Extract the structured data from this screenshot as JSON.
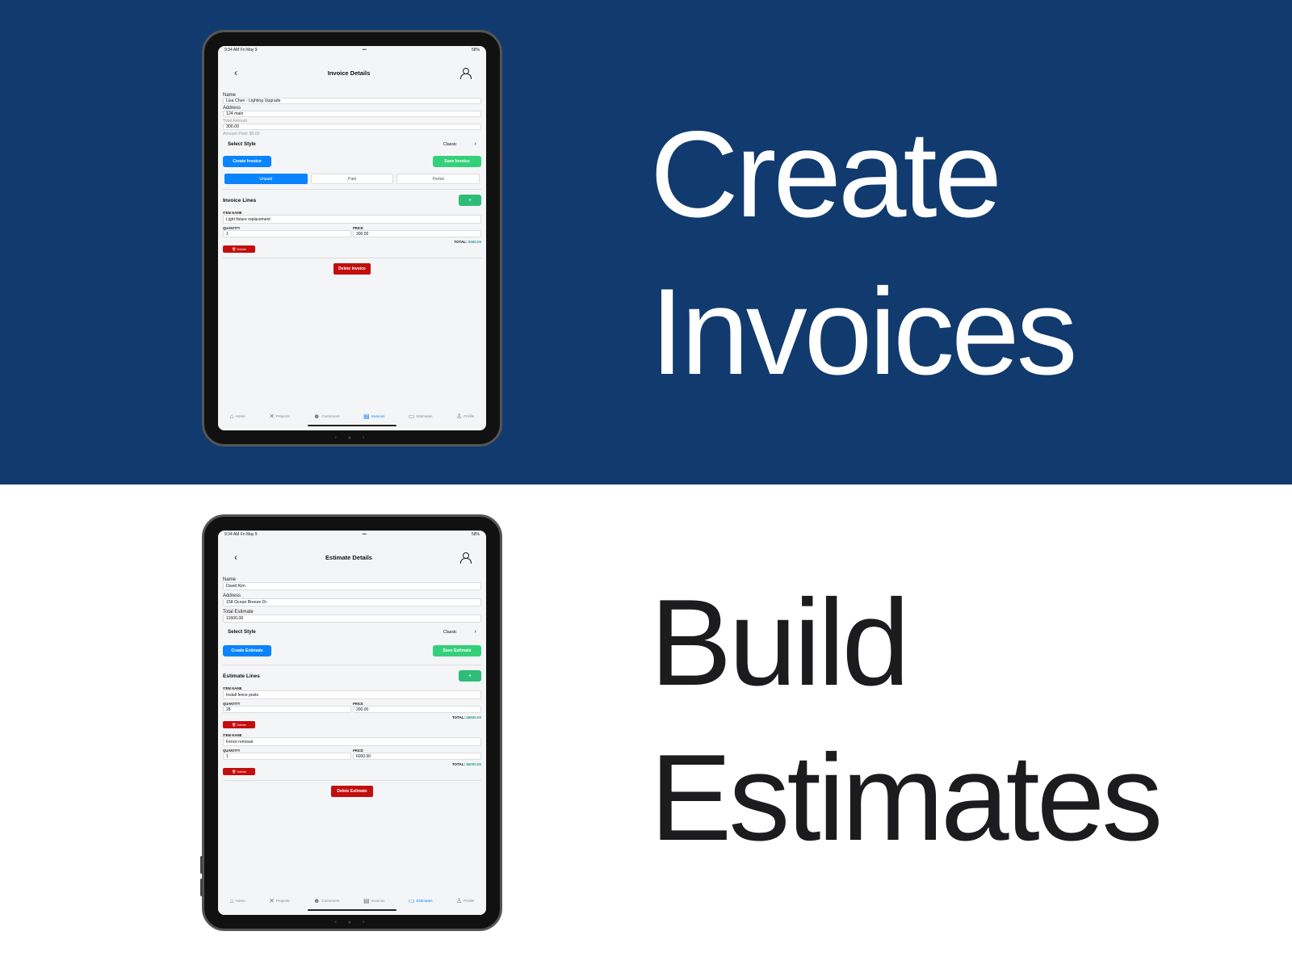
{
  "headlines": {
    "create": "Create",
    "invoices": "Invoices",
    "build": "Build",
    "estimates": "Estimates"
  },
  "colors": {
    "top_band": "#113a6e",
    "primary_blue": "#0a84ff",
    "save_green": "#34d17a",
    "delete_red": "#c40d0d",
    "total_teal": "#2a9d8f"
  },
  "invoice": {
    "status": {
      "time": "9:34 AM   Fri May 9",
      "dots": "•••",
      "battery": "58%"
    },
    "title": "Invoice Details",
    "name_label": "Name",
    "name_value": "Lisa Chen - Lighting Upgrade",
    "address_label": "Address",
    "address_value": "124 main",
    "total_label": "Total Amount",
    "total_value": "300.00",
    "amount_paid": "Amount Paid: $0.00",
    "style_label": "Select Style",
    "style_value": "Classic",
    "create_button": "Create Invoice",
    "save_button": "Save Invoice",
    "segments": [
      "Unpaid",
      "Paid",
      "Partial"
    ],
    "lines_title": "Invoice Lines",
    "add_label": "+",
    "item_label": "ITEM NAME",
    "qty_label": "QUANTITY",
    "price_label": "PRICE",
    "total_prefix": "TOTAL:",
    "delete_label": "Delete",
    "items": [
      {
        "name": "Light fixture replacement",
        "qty": "1",
        "price": "300.00",
        "total": "$300.00"
      }
    ],
    "delete_button": "Delete Invoice"
  },
  "estimate": {
    "status": {
      "time": "9:34 AM   Fri May 9",
      "dots": "•••",
      "battery": "58%"
    },
    "title": "Estimate Details",
    "name_label": "Name",
    "name_value": "David Kim",
    "address_label": "Address",
    "address_value": "158 Ocean Breeze Dr",
    "total_label": "Total Estimate",
    "total_value": "11600.00",
    "style_label": "Select Style",
    "style_value": "Classic",
    "create_button": "Create Estimate",
    "save_button": "Save Estimate",
    "lines_title": "Estimate Lines",
    "add_label": "+",
    "item_label": "ITEM NAME",
    "qty_label": "QUANTITY",
    "price_label": "PRICE",
    "total_prefix": "TOTAL:",
    "delete_label": "Delete",
    "items": [
      {
        "name": "Install fence posts",
        "qty": "28",
        "price": "200.00",
        "total": "$5600.00"
      },
      {
        "name": "Fence removal",
        "qty": "1",
        "price": "6000.00",
        "total": "$6000.00"
      }
    ],
    "delete_button": "Delete Estimate"
  },
  "tabs": [
    {
      "label": "Home",
      "icon": "home-icon"
    },
    {
      "label": "Projects",
      "icon": "tools-icon"
    },
    {
      "label": "Customers",
      "icon": "people-icon"
    },
    {
      "label": "Invoices",
      "icon": "document-icon"
    },
    {
      "label": "Estimates",
      "icon": "clipboard-icon"
    },
    {
      "label": "Profile",
      "icon": "person-icon"
    }
  ]
}
